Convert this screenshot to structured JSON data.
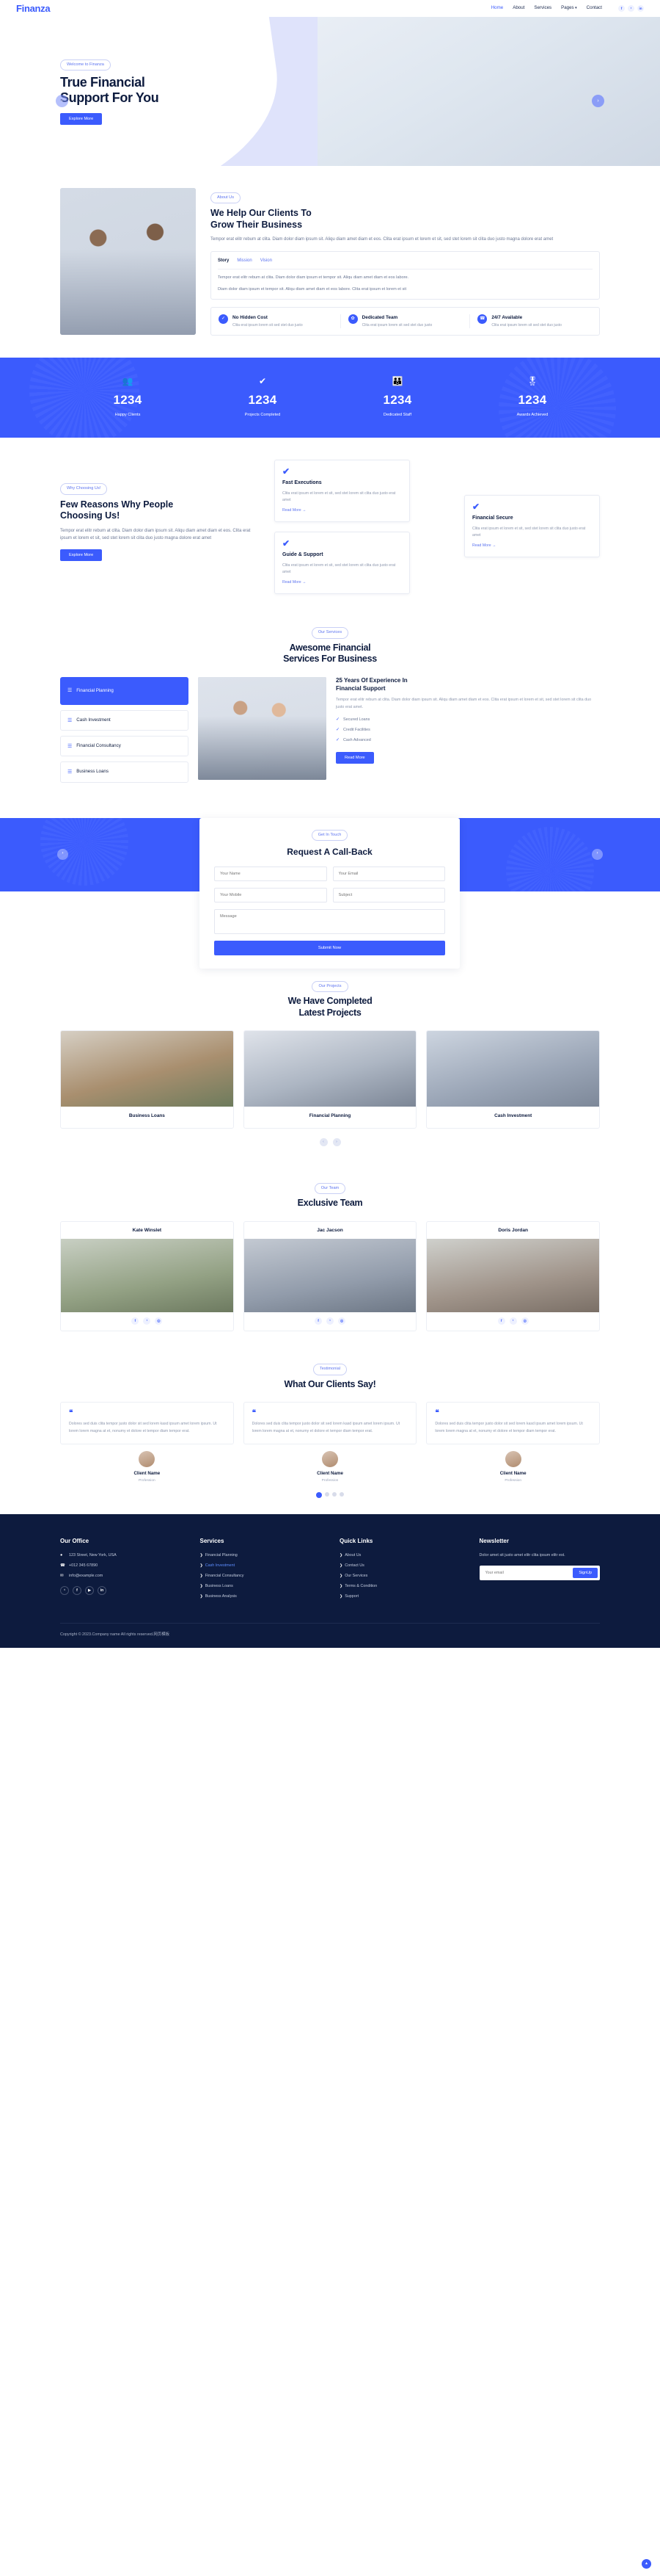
{
  "brand": {
    "name": "Finanza",
    "accent": "#3b5bfd",
    "dark": "#0d1b3e"
  },
  "nav": {
    "items": [
      {
        "label": "Home",
        "active": true
      },
      {
        "label": "About",
        "active": false
      },
      {
        "label": "Services",
        "active": false
      },
      {
        "label": "Pages",
        "active": false,
        "caret": "▾"
      },
      {
        "label": "Contact",
        "active": false
      }
    ],
    "socials": [
      {
        "name": "facebook-icon",
        "glyph": "f"
      },
      {
        "name": "twitter-icon",
        "glyph": "ᵗ"
      },
      {
        "name": "linkedin-icon",
        "glyph": "in"
      }
    ]
  },
  "hero": {
    "eyebrow": "Welcome to Finanza",
    "title_line1": "True Financial",
    "title_line2": "Support For You",
    "cta": "Explore More",
    "prev": "‹",
    "next": "›"
  },
  "about": {
    "eyebrow": "About Us",
    "title_line1": "We Help Our Clients To",
    "title_line2": "Grow Their Business",
    "lead": "Tempor erat elitr rebum at clita. Diam dolor diam ipsum sit. Aliqu diam amet diam et eos. Clita erat ipsum et lorem et sit, sed stet lorem sit clita duo justo magna dolore erat amet",
    "tabs": [
      {
        "label": "Story",
        "active": true
      },
      {
        "label": "Mission",
        "active": false
      },
      {
        "label": "Vision",
        "active": false
      }
    ],
    "tab_body": [
      "Tempor erat elitr rebum at clita. Diam dolor diam ipsum et tempor sit. Aliqu diam amet diam et eos labore.",
      "Diam dolor diam ipsum et tempor sit. Aliqu diam amet diam et eos labore. Clita erat ipsum et lorem et sit"
    ],
    "features": [
      {
        "icon": "check-icon",
        "glyph": "✓",
        "title": "No Hidden Cost",
        "text": "Clita erat ipsum lorem sit sed stet duo justo"
      },
      {
        "icon": "users-icon",
        "glyph": "✿",
        "title": "Dedicated Team",
        "text": "Clita erat ipsum lorem sit sed stet duo justo"
      },
      {
        "icon": "phone-icon",
        "glyph": "☎",
        "title": "24/7 Available",
        "text": "Clita erat ipsum lorem sit sed stet duo justo"
      }
    ]
  },
  "facts": [
    {
      "icon": "people-group-icon",
      "glyph": "👥",
      "number": "1234",
      "label": "Happy Clients"
    },
    {
      "icon": "check-mark-icon",
      "glyph": "✔",
      "number": "1234",
      "label": "Projects Completed"
    },
    {
      "icon": "staff-gear-icon",
      "glyph": "👪",
      "number": "1234",
      "label": "Dedicated Staff"
    },
    {
      "icon": "award-medal-icon",
      "glyph": "🎖",
      "number": "1234",
      "label": "Awards Achieved"
    }
  ],
  "why": {
    "eyebrow": "Why Choosing Us!",
    "title_line1": "Few Reasons Why People",
    "title_line2": "Choosing Us!",
    "lead": "Tempor erat elitr rebum at clita. Diam dolor diam ipsum sit. Aliqu diam amet diam et eos. Clita erat ipsum et lorem et sit, sed stet lorem sit clita duo justo magna dolore erat amet",
    "cta": "Explore More",
    "cards": [
      {
        "icon": "check-icon",
        "glyph": "✔",
        "title": "Fast Executions",
        "text": "Clita erat ipsum et lorem et sit, sed stet lorem sit clita duo justo erat amet",
        "link": "Read More",
        "arrow": "→"
      },
      {
        "icon": "check-icon",
        "glyph": "✔",
        "title": "Guide & Support",
        "text": "Clita erat ipsum et lorem et sit, sed stet lorem sit clita duo justo erat amet",
        "link": "Read More",
        "arrow": "→"
      },
      {
        "icon": "check-icon",
        "glyph": "✔",
        "title": "Financial Secure",
        "text": "Clita erat ipsum et lorem et sit, sed stet lorem sit clita duo justo erat amet",
        "link": "Read More",
        "arrow": "→"
      }
    ]
  },
  "services": {
    "eyebrow": "Our Services",
    "title_line1": "Awesome Financial",
    "title_line2": "Services For Business",
    "tabs": [
      {
        "label": "Financial Planning",
        "active": true
      },
      {
        "label": "Cash Investment",
        "active": false
      },
      {
        "label": "Financial Consultancy",
        "active": false
      },
      {
        "label": "Business Loans",
        "active": false
      }
    ],
    "panel": {
      "title_line1": "25 Years Of Experience In",
      "title_line2": "Financial Support",
      "text": "Tempor erat elitr rebum at clita. Diam dolor diam ipsum sit. Aliqu diam amet diam et eos. Clita erat ipsum et lorem et sit, sed stet lorem sit clita duo justo erat amet.",
      "bullets": [
        "Secured Loans",
        "Credit Facilities",
        "Cash Advanced"
      ],
      "cta": "Read More"
    }
  },
  "callback": {
    "eyebrow": "Get In Touch",
    "title": "Request A Call-Back",
    "fields": {
      "name": "Your Name",
      "email": "Your Email",
      "mobile": "Your Mobile",
      "subject": "Subject",
      "message": "Message"
    },
    "submit": "Submit Now",
    "prev": "‹",
    "next": "›"
  },
  "projects": {
    "eyebrow": "Our Projects",
    "title_line1": "We Have Completed",
    "title_line2": "Latest Projects",
    "items": [
      {
        "caption": "Business Loans"
      },
      {
        "caption": "Financial Planning"
      },
      {
        "caption": "Cash Investment"
      }
    ],
    "prev": "‹",
    "next": "›"
  },
  "team": {
    "eyebrow": "Our Team",
    "title": "Exclusive Team",
    "members": [
      {
        "name": "Kate Winslet",
        "socials": [
          "f",
          "ᵗ",
          "◎"
        ]
      },
      {
        "name": "Jac Jacson",
        "socials": [
          "f",
          "ᵗ",
          "◎"
        ]
      },
      {
        "name": "Doris Jordan",
        "socials": [
          "f",
          "ᵗ",
          "◎"
        ]
      }
    ]
  },
  "testimonials": {
    "eyebrow": "Testimonial",
    "title": "What Our Clients Say!",
    "items": [
      {
        "mark": "❝",
        "quote": "Dolores sed duis clita tempor justo dolor sit sed lorem kasd ipsum amet lorem ipsum. Ut lorem lorem magna at et, nonumy et dolore et tempor diam tempor erat.",
        "name": "Client Name",
        "role": "Profession"
      },
      {
        "mark": "❝",
        "quote": "Dolores sed duis clita tempor justo dolor sit sed lorem kasd ipsum amet lorem ipsum. Ut lorem lorem magna at et, nonumy et dolore et tempor diam tempor erat.",
        "name": "Client Name",
        "role": "Profession"
      },
      {
        "mark": "❝",
        "quote": "Dolores sed duis clita tempor justo dolor sit sed lorem kasd ipsum amet lorem ipsum. Ut lorem lorem magna at et, nonumy et dolore et tempor diam tempor erat.",
        "name": "Client Name",
        "role": "Profession"
      }
    ],
    "pager": [
      true,
      false,
      false,
      false
    ]
  },
  "footer": {
    "office": {
      "heading": "Our Office",
      "address": "123 Street, New York, USA",
      "phone": "+012 345 67890",
      "email": "info@example.com",
      "socials": [
        {
          "name": "twitter-icon",
          "glyph": "ᵗ"
        },
        {
          "name": "facebook-icon",
          "glyph": "f"
        },
        {
          "name": "youtube-icon",
          "glyph": "▶"
        },
        {
          "name": "linkedin-icon",
          "glyph": "in"
        }
      ]
    },
    "services": {
      "heading": "Services",
      "links": [
        {
          "label": "Financial Planning",
          "highlight": false
        },
        {
          "label": "Cash Investment",
          "highlight": true
        },
        {
          "label": "Financial Consultancy",
          "highlight": false
        },
        {
          "label": "Business Loans",
          "highlight": false
        },
        {
          "label": "Business Analysis",
          "highlight": false
        }
      ]
    },
    "quick": {
      "heading": "Quick Links",
      "links": [
        {
          "label": "About Us",
          "highlight": false
        },
        {
          "label": "Contact Us",
          "highlight": false
        },
        {
          "label": "Our Services",
          "highlight": false
        },
        {
          "label": "Terms & Condition",
          "highlight": false
        },
        {
          "label": "Support",
          "highlight": false
        }
      ]
    },
    "newsletter": {
      "heading": "Newsletter",
      "text": "Dolor amet sit justo amet elitr clita ipsum elitr est.",
      "placeholder": "Your email",
      "button": "SignUp"
    },
    "copyright": "Copyright © 2023.Company name All rights reserved.网页模板",
    "to_top": "▴"
  }
}
